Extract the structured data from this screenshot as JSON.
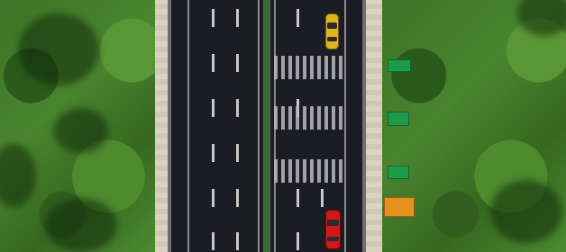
{
  "scene": {
    "type": "top-down-road",
    "colors": {
      "grass": "#3d7426",
      "road": "#1b1c24",
      "sidewalk": "#d9d3c2",
      "lane_marking": "#c8c8c8",
      "sign_green": "#1d9b4a",
      "sign_orange": "#e8901c",
      "car_yellow": "#e0b41c",
      "car_red": "#d11818"
    },
    "vehicles": [
      {
        "name": "yellow-car",
        "color": "#e0b41c",
        "direction": "up"
      },
      {
        "name": "red-car",
        "color": "#d11818",
        "direction": "up"
      }
    ],
    "signs": [
      {
        "name": "green-sign",
        "color": "#1d9b4a",
        "label": ""
      },
      {
        "name": "green-sign",
        "color": "#1d9b4a",
        "label": ""
      },
      {
        "name": "green-sign",
        "color": "#1d9b4a",
        "label": ""
      },
      {
        "name": "orange-sign",
        "color": "#e8901c",
        "label": ""
      }
    ]
  }
}
